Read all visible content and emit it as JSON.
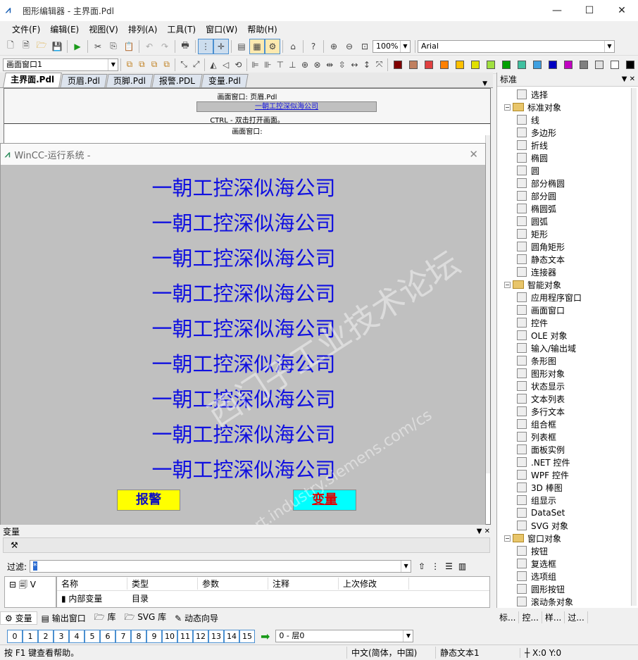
{
  "app": {
    "title": "图形编辑器 - 主界面.Pdl",
    "icon": "wincc-icon"
  },
  "menu": [
    "文件(F)",
    "编辑(E)",
    "视图(V)",
    "排列(A)",
    "工具(T)",
    "窗口(W)",
    "帮助(H)"
  ],
  "toolbar": {
    "zoom": "100%",
    "font": "Arial",
    "object_combo": "画面窗口1"
  },
  "palette": [
    "#800000",
    "#c08060",
    "#e04040",
    "#ff8000",
    "#ffc000",
    "#e0e000",
    "#a0e040",
    "#00a000",
    "#40c0a0",
    "#40a0e0",
    "#0000c0",
    "#c000c0",
    "#808080",
    "#e0e0e0",
    "#ffffff",
    "#000000"
  ],
  "tabs": [
    "主界面.Pdl",
    "页眉.Pdl",
    "页脚.Pdl",
    "报警.PDL",
    "变量.Pdl"
  ],
  "canvas": {
    "window_label_top": "画面窗口: 页眉.Pdl",
    "company_small": "一朝工控深似海公司",
    "hint": "CTRL - 双击打开画面。",
    "window_label_2": "画面窗口:"
  },
  "runtime": {
    "title": "WinCC-运行系统 -",
    "lines": [
      "一朝工控深似海公司",
      "一朝工控深似海公司",
      "一朝工控深似海公司",
      "一朝工控深似海公司",
      "一朝工控深似海公司",
      "一朝工控深似海公司",
      "一朝工控深似海公司",
      "一朝工控深似海公司",
      "一朝工控深似海公司"
    ],
    "alarm_button": "报警",
    "variable_button": "变量",
    "alarm_color": "#ffff00",
    "var_color": "#00ffff"
  },
  "panel": {
    "title": "标准",
    "items": [
      {
        "label": "选择",
        "level": 1,
        "icon": "cursor-icon"
      },
      {
        "label": "标准对象",
        "level": 0,
        "icon": "folder-icon"
      },
      {
        "label": "线",
        "level": 1,
        "icon": "line-icon"
      },
      {
        "label": "多边形",
        "level": 1,
        "icon": "polygon-icon"
      },
      {
        "label": "折线",
        "level": 1,
        "icon": "polyline-icon"
      },
      {
        "label": "椭圆",
        "level": 1,
        "icon": "ellipse-icon"
      },
      {
        "label": "圆",
        "level": 1,
        "icon": "circle-icon"
      },
      {
        "label": "部分椭圆",
        "level": 1,
        "icon": "ellipse-segment-icon"
      },
      {
        "label": "部分圆",
        "level": 1,
        "icon": "circle-segment-icon"
      },
      {
        "label": "椭圆弧",
        "level": 1,
        "icon": "ellipse-arc-icon"
      },
      {
        "label": "圆弧",
        "level": 1,
        "icon": "circle-arc-icon"
      },
      {
        "label": "矩形",
        "level": 1,
        "icon": "rectangle-icon"
      },
      {
        "label": "圆角矩形",
        "level": 1,
        "icon": "rounded-rectangle-icon"
      },
      {
        "label": "静态文本",
        "level": 1,
        "icon": "static-text-icon"
      },
      {
        "label": "连接器",
        "level": 1,
        "icon": "connector-icon"
      },
      {
        "label": "智能对象",
        "level": 0,
        "icon": "folder-icon"
      },
      {
        "label": "应用程序窗口",
        "level": 1,
        "icon": "app-window-icon"
      },
      {
        "label": "画面窗口",
        "level": 1,
        "icon": "picture-window-icon"
      },
      {
        "label": "控件",
        "level": 1,
        "icon": "ocx-icon"
      },
      {
        "label": "OLE 对象",
        "level": 1,
        "icon": "ole-icon"
      },
      {
        "label": "输入/输出域",
        "level": 1,
        "icon": "io-field-icon"
      },
      {
        "label": "条形图",
        "level": 1,
        "icon": "bar-icon"
      },
      {
        "label": "图形对象",
        "level": 1,
        "icon": "graphic-object-icon"
      },
      {
        "label": "状态显示",
        "level": 1,
        "icon": "status-display-icon"
      },
      {
        "label": "文本列表",
        "level": 1,
        "icon": "text-list-icon"
      },
      {
        "label": "多行文本",
        "level": 1,
        "icon": "multiline-text-icon"
      },
      {
        "label": "组合框",
        "level": 1,
        "icon": "combobox-icon"
      },
      {
        "label": "列表框",
        "level": 1,
        "icon": "listbox-icon"
      },
      {
        "label": "面板实例",
        "level": 1,
        "icon": "faceplate-icon"
      },
      {
        "label": ".NET 控件",
        "level": 1,
        "icon": "dotnet-icon"
      },
      {
        "label": "WPF 控件",
        "level": 1,
        "icon": "wpf-icon"
      },
      {
        "label": "3D 棒图",
        "level": 1,
        "icon": "3d-bar-icon"
      },
      {
        "label": "组显示",
        "level": 1,
        "icon": "group-display-icon"
      },
      {
        "label": "DataSet",
        "level": 1,
        "icon": "dataset-icon"
      },
      {
        "label": "SVG 对象",
        "level": 1,
        "icon": "svg-icon"
      },
      {
        "label": "窗口对象",
        "level": 0,
        "icon": "folder-icon"
      },
      {
        "label": "按钮",
        "level": 1,
        "icon": "button-icon"
      },
      {
        "label": "复选框",
        "level": 1,
        "icon": "checkbox-icon"
      },
      {
        "label": "选项组",
        "level": 1,
        "icon": "radio-group-icon"
      },
      {
        "label": "圆形按钮",
        "level": 1,
        "icon": "round-button-icon"
      },
      {
        "label": "滚动条对象",
        "level": 1,
        "icon": "scrollbar-icon"
      }
    ],
    "tabs": [
      "标...",
      "控...",
      "样...",
      "过..."
    ]
  },
  "variables": {
    "title": "变量",
    "filter_label": "过滤:",
    "filter_value": "*",
    "tree_root": "V",
    "columns": [
      "名称",
      "类型",
      "参数",
      "注释",
      "上次修改"
    ],
    "row": {
      "name": "内部变量",
      "type": "目录"
    }
  },
  "bottom_tabs": [
    "变量",
    "输出窗口",
    "库",
    "SVG 库",
    "动态向导"
  ],
  "layers": {
    "buttons": [
      "0",
      "1",
      "2",
      "3",
      "4",
      "5",
      "6",
      "7",
      "8",
      "9",
      "10",
      "11",
      "12",
      "13",
      "14",
      "15"
    ],
    "current": "0 - 层0"
  },
  "status": {
    "help": "按 F1 键查看帮助。",
    "lang": "中文(简体，中国)",
    "object": "静态文本1",
    "coords": "X:0 Y:0"
  },
  "watermark": {
    "text1": "西门子工业技术论坛",
    "text2": "support.industry.siemens.com/cs"
  }
}
